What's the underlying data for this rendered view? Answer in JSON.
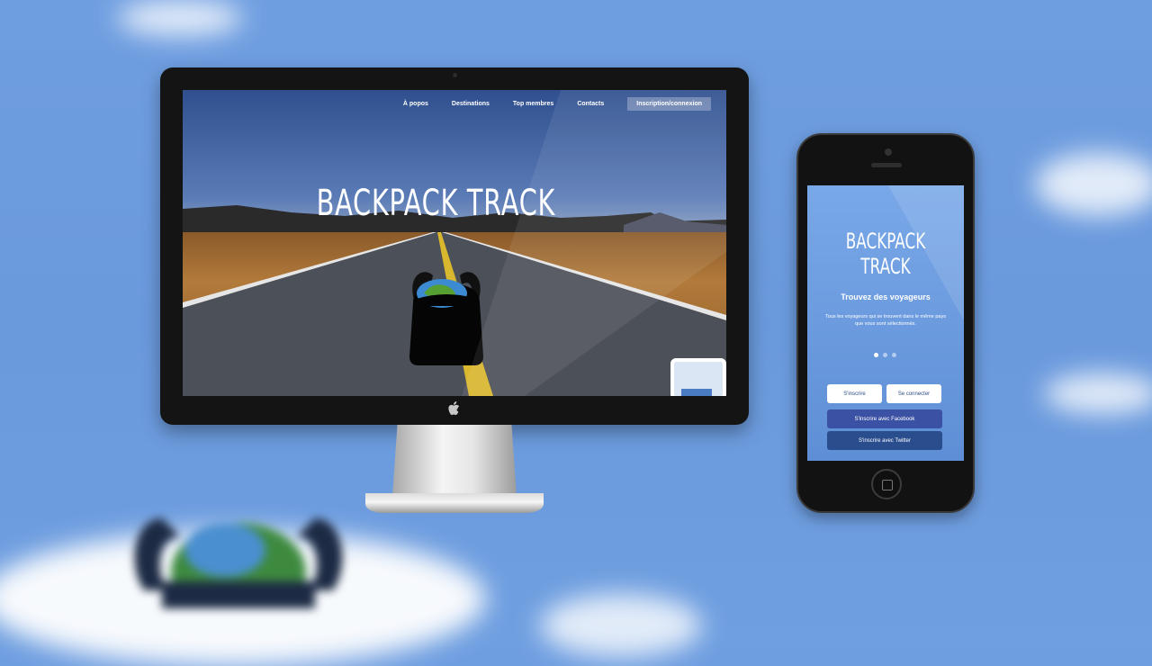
{
  "desktop": {
    "nav": [
      {
        "label": "À popos"
      },
      {
        "label": "Destinations"
      },
      {
        "label": "Top membres"
      },
      {
        "label": "Contacts"
      }
    ],
    "cta_label": "Inscription/connexion",
    "title": "BACKPACK TRACK"
  },
  "mobile": {
    "title": "BACKPACK TRACK",
    "heading": "Trouvez des voyageurs",
    "description": "Tous les voyageurs qui se trouvent dans le même pays que vous sont sélectionnés.",
    "carousel": {
      "total": 3,
      "active": 1
    },
    "buttons": {
      "signup": "S'inscrire",
      "login": "Se connecter",
      "facebook": "S'inscrire avec Facebook",
      "twitter": "S'inscrire avec Twitter"
    }
  },
  "colors": {
    "background": "#6a99dc",
    "facebook": "#3b52a4",
    "twitter": "#2a4d8e"
  },
  "icons": {
    "apple": "apple-icon",
    "backpack": "backpack-globe-icon"
  }
}
